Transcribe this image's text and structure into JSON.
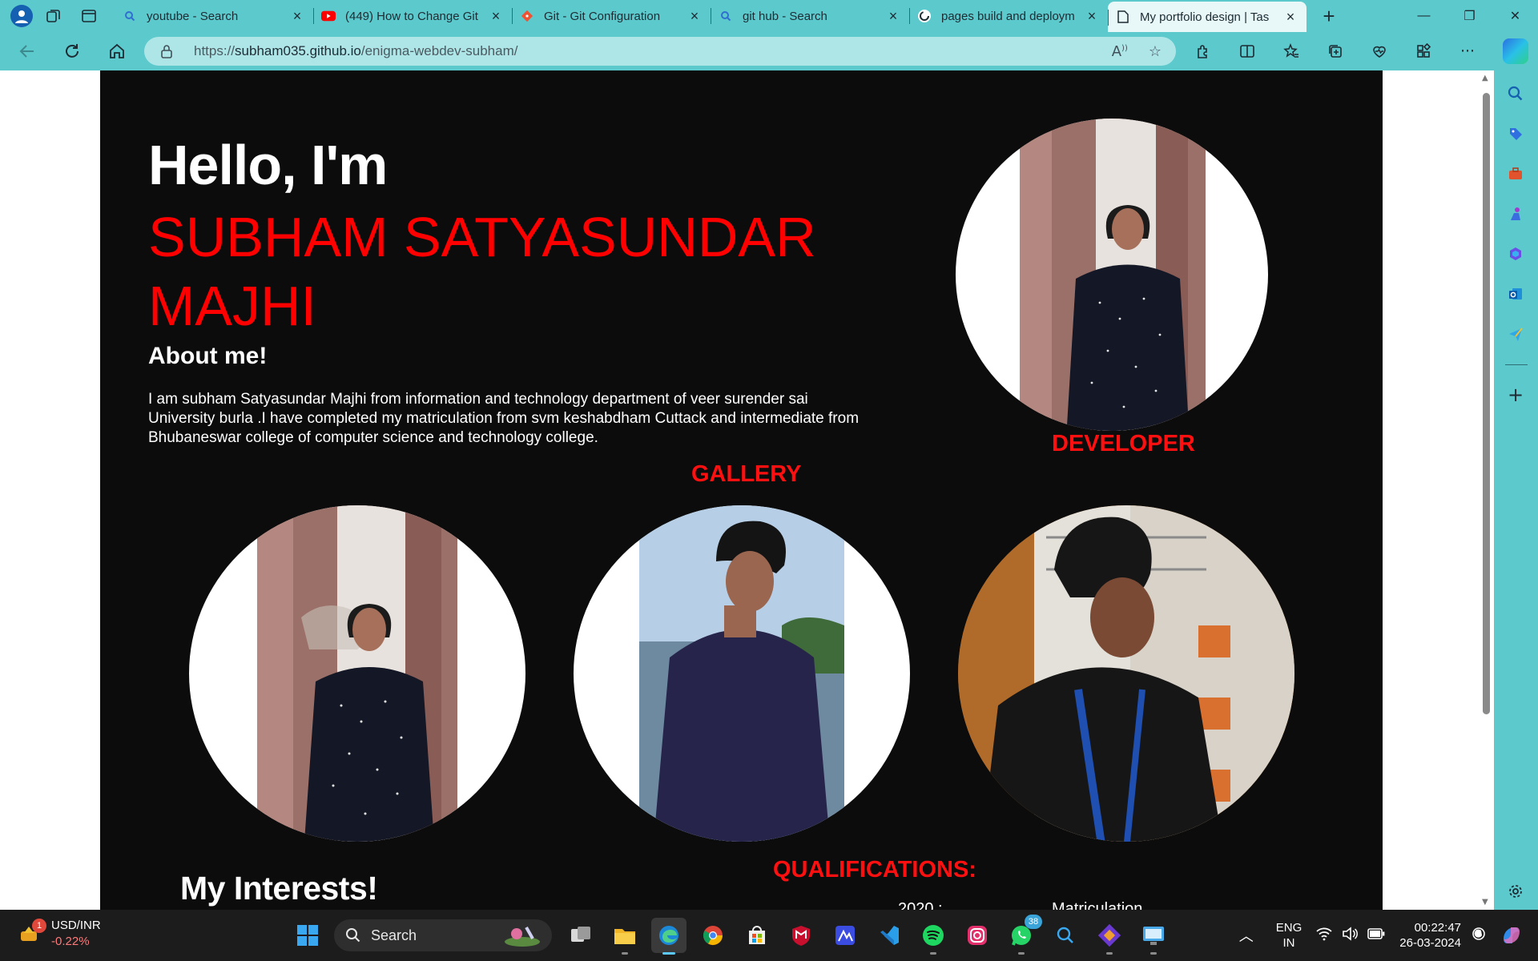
{
  "browser": {
    "tabs": [
      {
        "title": "youtube - Search",
        "icon": "search-icon"
      },
      {
        "title": "(449) How to Change Git",
        "icon": "youtube-icon"
      },
      {
        "title": "Git - Git Configuration",
        "icon": "git-icon"
      },
      {
        "title": "git hub - Search",
        "icon": "search-icon"
      },
      {
        "title": "pages build and deploym",
        "icon": "github-icon"
      },
      {
        "title": "My portfolio design | Tas",
        "icon": "page-icon",
        "active": true
      }
    ],
    "url_prefix": "https://",
    "url_host": "subham035.github.io",
    "url_path": "/enigma-webdev-subham/"
  },
  "page": {
    "greeting": "Hello, I'm",
    "name": "SUBHAM SATYASUNDAR MAJHI",
    "about_heading": "About me!",
    "about_text": "I am subham Satyasundar Majhi from information and technology department of veer surender sai University burla .I have completed my matriculation from svm keshabdham Cuttack and intermediate from Bhubaneswar college of computer science and technology college.",
    "role": "DEVELOPER",
    "gallery_heading": "GALLERY",
    "interests_heading": "My Interests!",
    "qualifications_heading": "QUALIFICATIONS:",
    "qualification_year": "2020 :",
    "qualification_item": "Matriculation"
  },
  "taskbar": {
    "ticker_name": "USD/INR",
    "ticker_change": "-0.22%",
    "ticker_badge": "1",
    "search_label": "Search",
    "whatsapp_badge": "38",
    "lang_line1": "ENG",
    "lang_line2": "IN",
    "time": "00:22:47",
    "date": "26-03-2024"
  },
  "colors": {
    "accent_teal": "#5cc9cc",
    "name_red": "#ff0000",
    "page_bg": "#0c0c0c"
  }
}
